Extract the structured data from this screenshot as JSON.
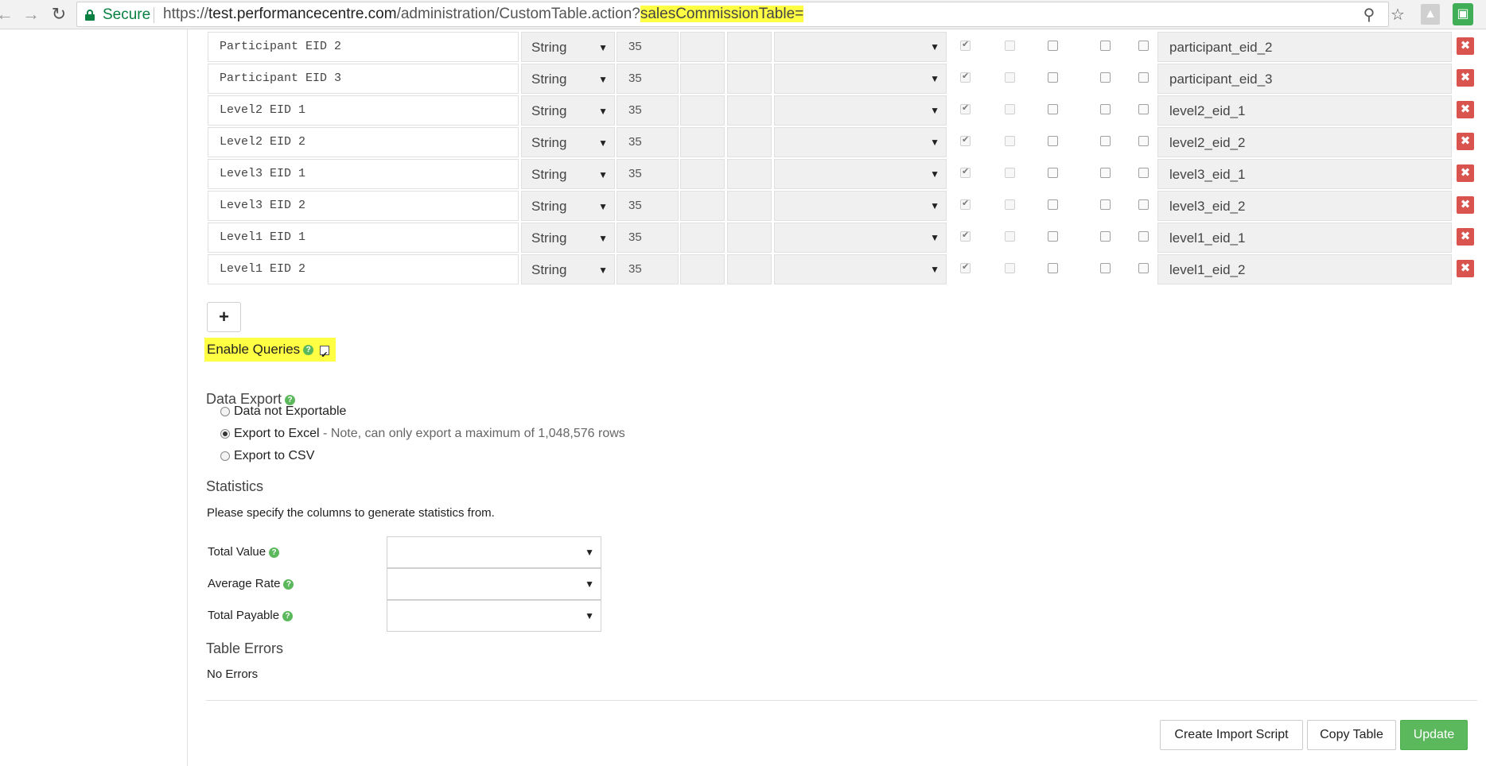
{
  "browser": {
    "secure_label": "Secure",
    "url_scheme": "https://",
    "url_host": "test.performancecentre.com",
    "url_path": "/administration/CustomTable.action?",
    "url_highlight": "salesCommissionTable",
    "url_tail": "="
  },
  "rows": [
    {
      "name": "Participant EID 2",
      "type": "String",
      "length": "35",
      "db": "participant_eid_2"
    },
    {
      "name": "Participant EID 3",
      "type": "String",
      "length": "35",
      "db": "participant_eid_3"
    },
    {
      "name": "Level2 EID 1",
      "type": "String",
      "length": "35",
      "db": "level2_eid_1"
    },
    {
      "name": "Level2 EID 2",
      "type": "String",
      "length": "35",
      "db": "level2_eid_2"
    },
    {
      "name": "Level3 EID 1",
      "type": "String",
      "length": "35",
      "db": "level3_eid_1"
    },
    {
      "name": "Level3 EID 2",
      "type": "String",
      "length": "35",
      "db": "level3_eid_2"
    },
    {
      "name": "Level1 EID 1",
      "type": "String",
      "length": "35",
      "db": "level1_eid_1"
    },
    {
      "name": "Level1 EID 2",
      "type": "String",
      "length": "35",
      "db": "level1_eid_2"
    }
  ],
  "add_label": "+",
  "enable_queries": {
    "label": "Enable Queries",
    "checked": true
  },
  "data_export": {
    "heading": "Data Export",
    "options": [
      {
        "label": "Data not Exportable",
        "note": "",
        "selected": false
      },
      {
        "label": "Export to Excel",
        "note": " - Note, can only export a maximum of 1,048,576 rows",
        "selected": true
      },
      {
        "label": "Export to CSV",
        "note": "",
        "selected": false
      }
    ]
  },
  "statistics": {
    "heading": "Statistics",
    "description": "Please specify the columns to generate statistics from.",
    "fields": [
      {
        "label": "Total Value",
        "value": ""
      },
      {
        "label": "Average Rate",
        "value": ""
      },
      {
        "label": "Total Payable",
        "value": ""
      }
    ]
  },
  "table_errors": {
    "heading": "Table Errors",
    "text": "No Errors"
  },
  "buttons": {
    "import": "Create Import Script",
    "copy": "Copy Table",
    "update": "Update"
  },
  "colors": {
    "accent_green": "#5cb85c",
    "delete_red": "#d9534f",
    "highlight": "#ffff44"
  },
  "icons": [
    "back-icon",
    "forward-icon",
    "reload-icon",
    "lock-icon",
    "zoom-icon",
    "star-icon",
    "delete-icon",
    "help-icon",
    "caret-down-icon"
  ]
}
